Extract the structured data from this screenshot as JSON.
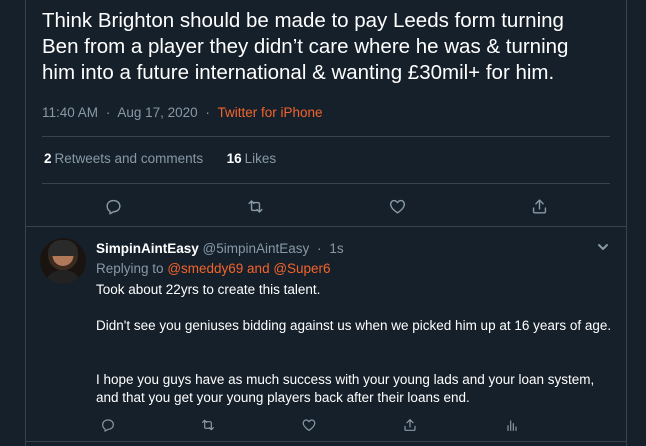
{
  "tweet": {
    "text": "Think Brighton should be made to pay Leeds form turning\nBen from a player they didn’t care where he was & turning\nhim into a future international & wanting £30mil+ for him.",
    "time": "11:40 AM",
    "date": "Aug 17, 2020",
    "separator": "·",
    "source": "Twitter for iPhone",
    "retweets_count": "2",
    "retweets_label": "Retweets and comments",
    "likes_count": "16",
    "likes_label": "Likes",
    "actions": {
      "reply_icon": "reply-icon",
      "retweet_icon": "retweet-icon",
      "like_icon": "heart-icon",
      "share_icon": "share-icon"
    }
  },
  "reply": {
    "display_name": "SimpinAintEasy",
    "handle": "@5impinAintEasy",
    "separator": "·",
    "time_ago": "1s",
    "replying_prefix": "Replying to",
    "replying_mentions": "@smeddy69 and @Super6",
    "paragraph1": "Took about 22yrs to create this talent.",
    "paragraph2": "Didn't see you geniuses bidding against us when we picked him up at 16 years of age.",
    "paragraph3": "I hope you guys have as much success with your young lads and your loan system, and that you get your young players back after their loans end.",
    "actions": {
      "reply_icon": "reply-icon",
      "retweet_icon": "retweet-icon",
      "like_icon": "heart-icon",
      "share_icon": "share-icon",
      "analytics_icon": "analytics-icon"
    }
  },
  "colors": {
    "background": "#15202b",
    "border": "#38444d",
    "secondary_text": "#8899a6",
    "accent": "#f4632b"
  }
}
